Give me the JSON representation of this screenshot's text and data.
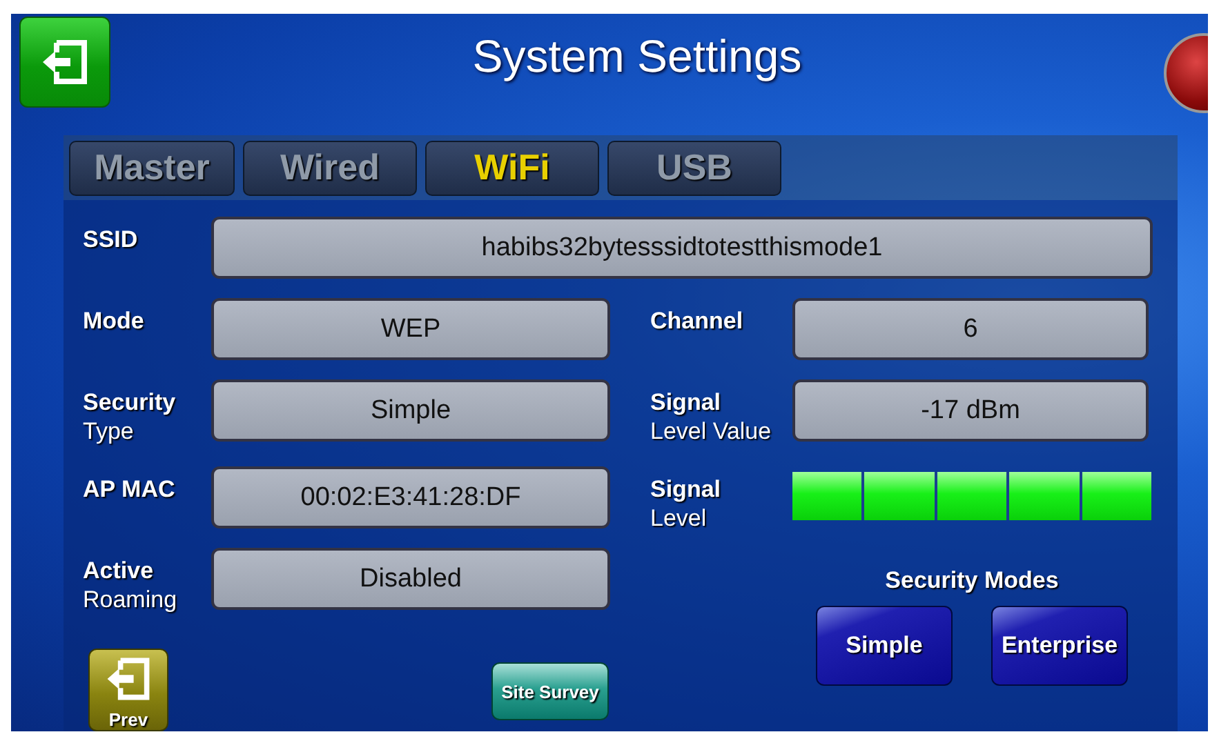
{
  "title": "System Settings",
  "tabs": [
    {
      "label": "Master",
      "selected": false
    },
    {
      "label": "Wired",
      "selected": false
    },
    {
      "label": "WiFi",
      "selected": true
    },
    {
      "label": "USB",
      "selected": false
    }
  ],
  "ssid": {
    "label": "SSID",
    "value": "habibs32bytesssidtotestthismode1"
  },
  "left_fields": [
    {
      "label": "Mode",
      "value": "WEP"
    },
    {
      "label": "Security",
      "sublabel": "Type",
      "value": "Simple"
    },
    {
      "label": "AP MAC",
      "value": "00:02:E3:41:28:DF"
    },
    {
      "label": "Active",
      "sublabel": "Roaming",
      "value": "Disabled"
    }
  ],
  "right_fields": [
    {
      "label": "Channel",
      "value": "6"
    },
    {
      "label": "Signal",
      "sublabel": "Level Value",
      "value": "-17 dBm"
    }
  ],
  "signal_meter": {
    "label": "Signal",
    "sublabel": "Level",
    "level": 1.0
  },
  "security_modes": {
    "title": "Security Modes",
    "buttons": [
      "Simple",
      "Enterprise"
    ]
  },
  "prev_button": "Prev",
  "site_survey_button": "Site Survey"
}
